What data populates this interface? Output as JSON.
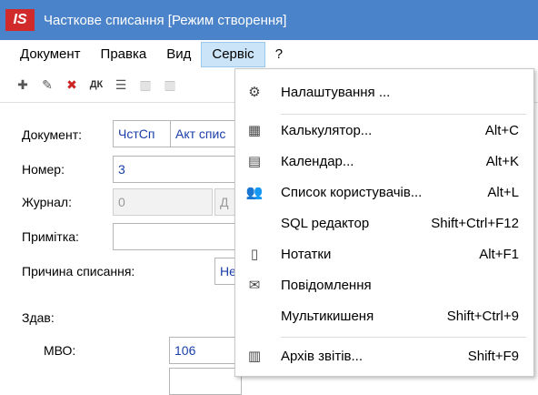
{
  "window": {
    "logo": "IS",
    "title": "Часткове списання [Режим створення]"
  },
  "menu": [
    "Документ",
    "Правка",
    "Вид",
    "Сервіс",
    "?"
  ],
  "form": {
    "document_label": "Документ:",
    "document_code": "ЧстСп",
    "document_type": "Акт спис",
    "number_label": "Номер:",
    "number_value": "3",
    "journal_label": "Журнал:",
    "journal_value": "0",
    "journal_partial": "Д",
    "note_label": "Примітка:",
    "reason_label": "Причина списання:",
    "reason_value": "Не",
    "handed_label": "Здав:",
    "mvo_label": "МВО:",
    "mvo_value": "106"
  },
  "service_menu": [
    {
      "label": "Налаштування ...",
      "shortcut": "",
      "icon": "gears-icon"
    },
    {
      "label": "Калькулятор...",
      "shortcut": "Alt+C",
      "icon": "calculator-icon"
    },
    {
      "label": "Календар...",
      "shortcut": "Alt+K",
      "icon": "calendar-icon"
    },
    {
      "label": "Список користувачів...",
      "shortcut": "Alt+L",
      "icon": "users-icon"
    },
    {
      "label": "SQL редактор",
      "shortcut": "Shift+Ctrl+F12",
      "icon": ""
    },
    {
      "label": "Нотатки",
      "shortcut": "Alt+F1",
      "icon": "notes-icon"
    },
    {
      "label": "Повідомлення",
      "shortcut": "",
      "icon": "envelope-icon"
    },
    {
      "label": "Мультикишеня",
      "shortcut": "Shift+Ctrl+9",
      "icon": ""
    },
    {
      "label": "Архів звітів...",
      "shortcut": "Shift+F9",
      "icon": "archive-icon"
    }
  ]
}
